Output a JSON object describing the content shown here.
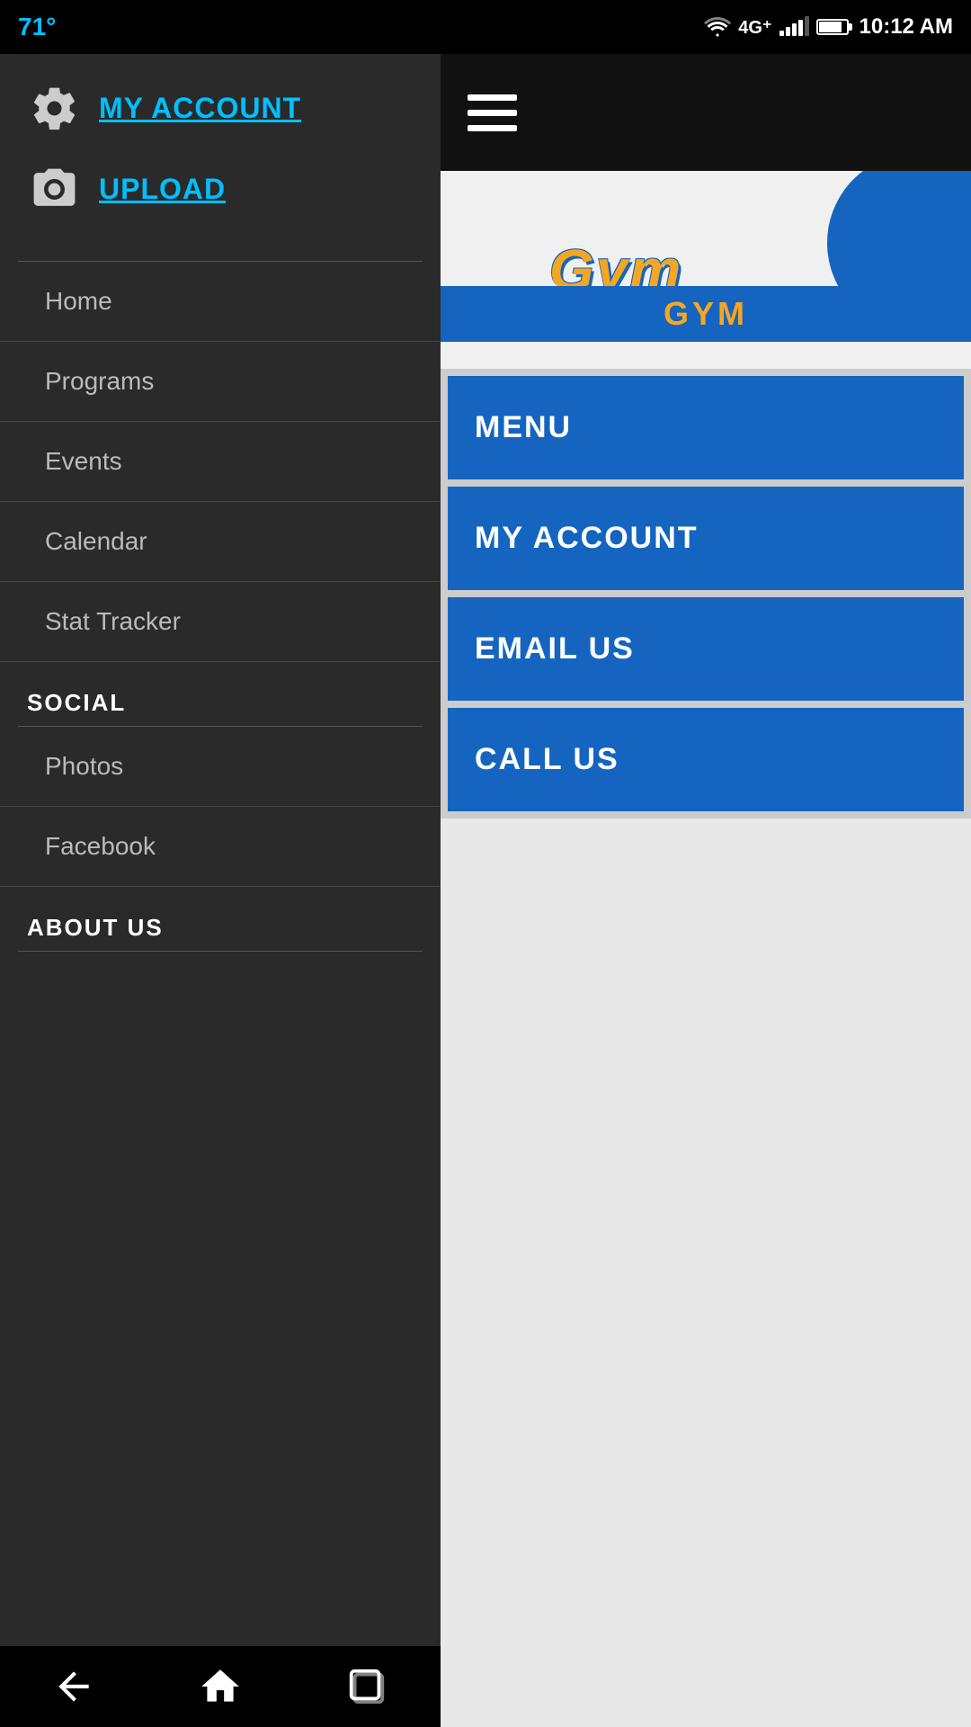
{
  "statusBar": {
    "temperature": "71°",
    "time": "10:12 AM"
  },
  "sidebar": {
    "myAccountLabel": "MY ACCOUNT",
    "uploadLabel": "UPLOAD",
    "navItems": [
      {
        "label": "Home"
      },
      {
        "label": "Programs"
      },
      {
        "label": "Events"
      },
      {
        "label": "Calendar"
      },
      {
        "label": "Stat Tracker"
      }
    ],
    "socialHeader": "SOCIAL",
    "socialItems": [
      {
        "label": "Photos"
      },
      {
        "label": "Facebook"
      }
    ],
    "aboutHeader": "ABOUT US"
  },
  "rightPanel": {
    "gymLogoText": "Gym",
    "gymSubText": "GYM",
    "menuButtons": [
      {
        "label": "MENU"
      },
      {
        "label": "MY ACCOUNT"
      },
      {
        "label": "EMAIL US"
      },
      {
        "label": "CALL US"
      }
    ]
  }
}
